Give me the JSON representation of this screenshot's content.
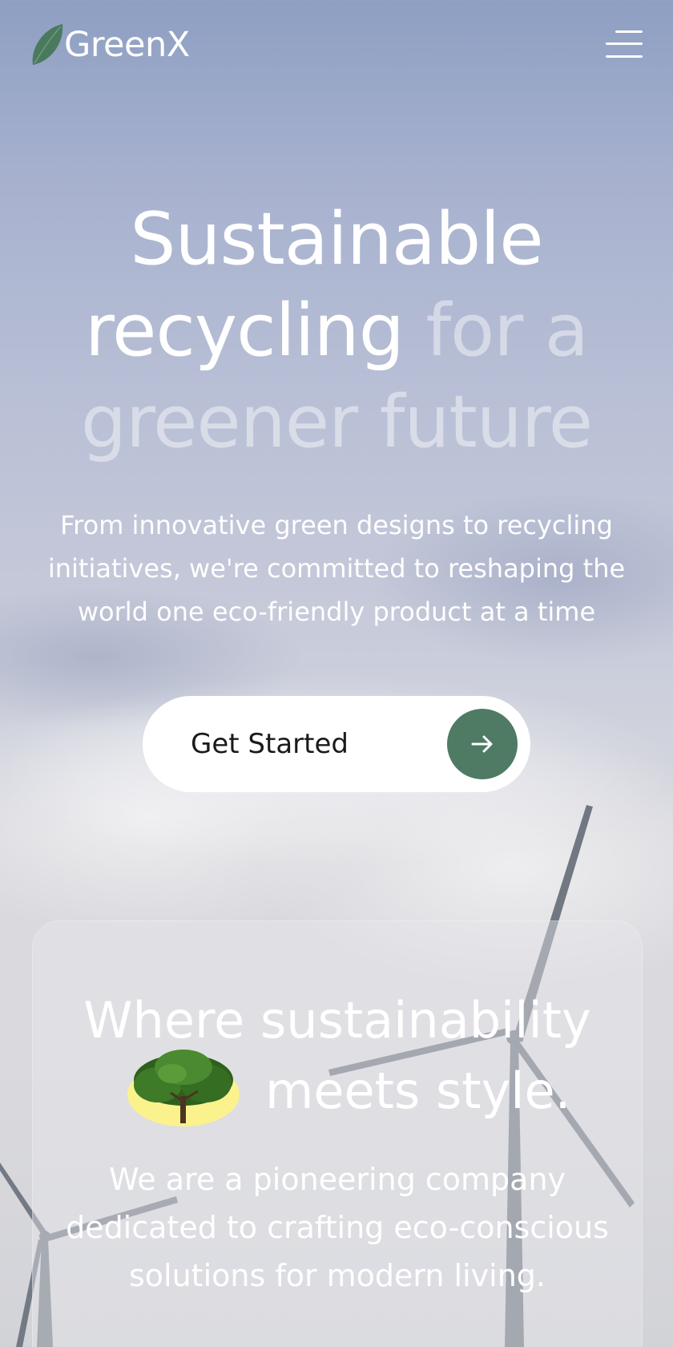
{
  "brand": {
    "name": "GreenX",
    "logo_icon": "leaf-icon"
  },
  "nav": {
    "menu_icon": "hamburger-menu-icon"
  },
  "hero": {
    "title_bright": "Sustainable recycling",
    "title_dim": "for a greener future",
    "subtitle": "From innovative green designs to recycling initiatives, we're committed to reshaping the world one eco-friendly product at a time",
    "cta_label": "Get Started",
    "cta_icon": "arrow-right-icon"
  },
  "about": {
    "title_line1": "Where sustainability",
    "title_line2": "meets style.",
    "image": "tree-image",
    "text": "We are a pioneering company dedicated to crafting eco-conscious solutions for modern living."
  },
  "colors": {
    "accent": "#4f7a64",
    "leaf": "#4a7a5e",
    "cta_background": "#ffffff"
  }
}
